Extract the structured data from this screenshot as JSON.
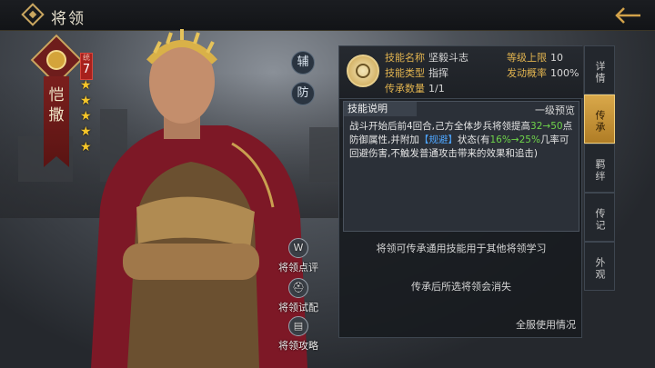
{
  "topbar": {
    "title": "将领"
  },
  "hero": {
    "name": "恺撒",
    "rank_label": "统",
    "rank_value": "7",
    "stars": 5,
    "role_buttons": [
      "辅",
      "防"
    ]
  },
  "actions": [
    {
      "label": "将领点评",
      "icon": "W"
    },
    {
      "label": "将领试配",
      "icon": "helmet"
    },
    {
      "label": "将领攻略",
      "icon": "book"
    }
  ],
  "skill": {
    "name_label": "技能名称",
    "name_value": "坚毅斗志",
    "type_label": "技能类型",
    "type_value": "指挥",
    "inherit_label": "传承数量",
    "inherit_value": "1/1",
    "level_cap_label": "等级上限",
    "level_cap_value": "10",
    "trigger_label": "发动概率",
    "trigger_value": "100%",
    "desc_tab": "技能说明",
    "desc_level": "一级预览",
    "desc_parts": {
      "p1": "战斗开始后前4回合,己方全体步兵将领提高",
      "p2": "32→50",
      "p3": "点防御属性,并附加",
      "p4": "【规避】",
      "p5": "状态(有",
      "p6": "16%→25%",
      "p7": "几率可回避伤害,不触发普通攻击带来的效果和追击)"
    },
    "note1": "将领可传承通用技能用于其他将领学习",
    "note2": "传承后所选将领会消失",
    "usage": "全服使用情况"
  },
  "tabs": [
    {
      "label": "详情",
      "active": false
    },
    {
      "label": "传承",
      "active": true
    },
    {
      "label": "羁绊",
      "active": false
    },
    {
      "label": "传记",
      "active": false
    },
    {
      "label": "外观",
      "active": false
    }
  ],
  "colors": {
    "accent": "#e1b34f",
    "green": "#6fd44a",
    "blue": "#4ea6ff",
    "rank": "#a8201c"
  }
}
